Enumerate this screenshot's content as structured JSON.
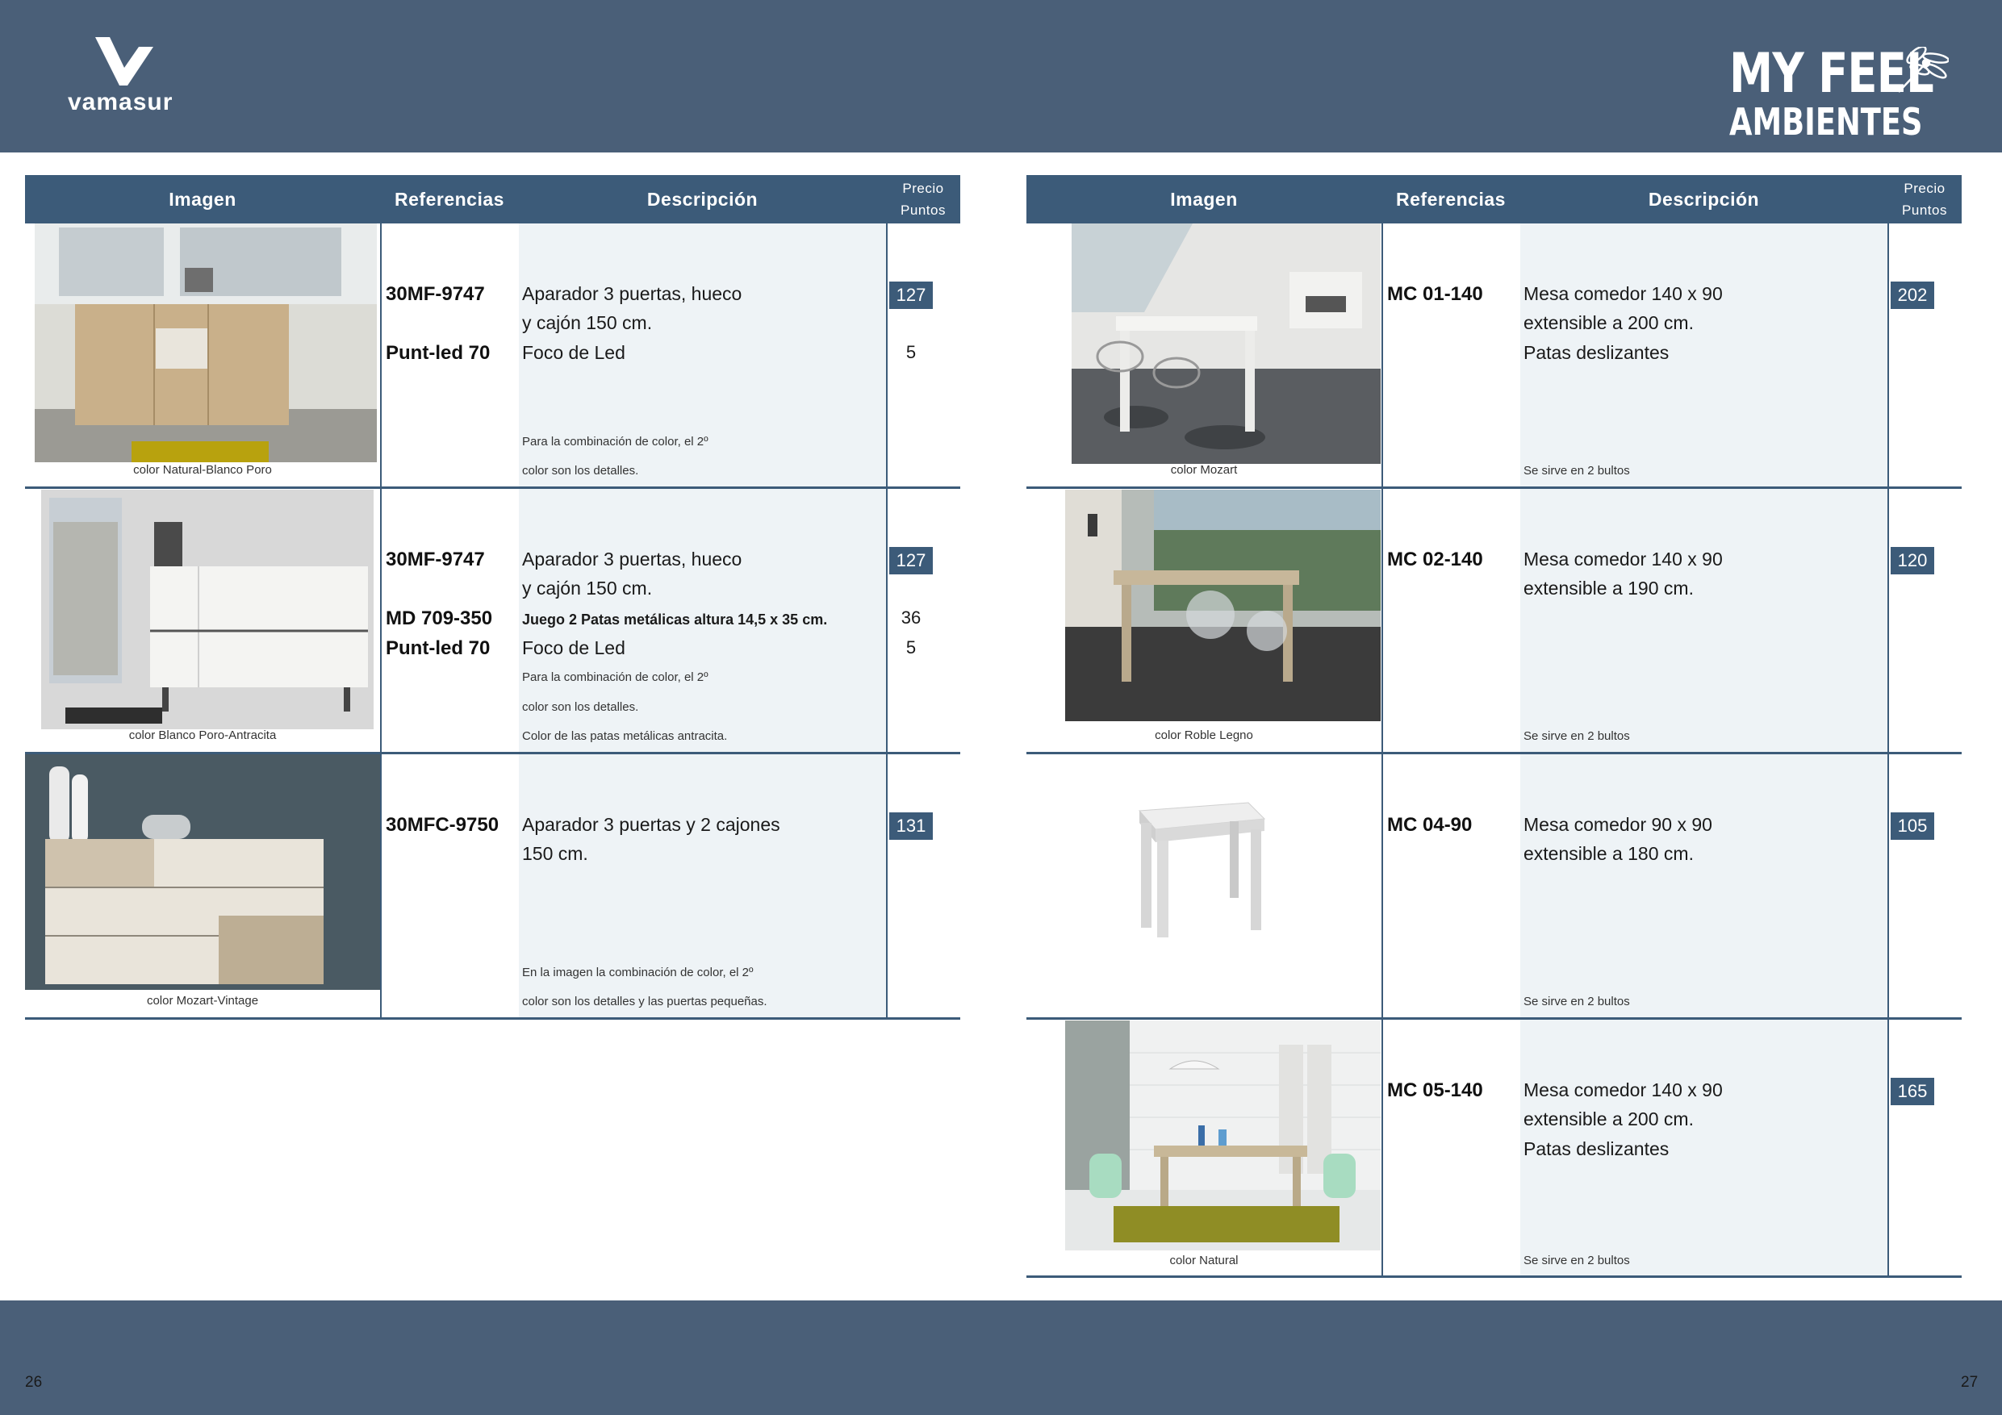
{
  "brand": {
    "left_logo": "vamasur",
    "right_line1": "MY FEEL",
    "right_line2": "AMBIENTES"
  },
  "columns": {
    "image": "Imagen",
    "refs": "Referencias",
    "desc": "Descripción",
    "price_line1": "Precio",
    "price_line2": "Puntos"
  },
  "pages": {
    "left": "26",
    "right": "27"
  },
  "left_rows": [
    {
      "caption": "color Natural-Blanco Poro",
      "refs": [
        "30MF-9747",
        "Punt-led 70"
      ],
      "desc": [
        "Aparador 3 puertas, hueco",
        "y cajón 150 cm.",
        "Foco de Led"
      ],
      "notes": [
        "Para la combinación de  color,  el  2º",
        "color son los detalles."
      ],
      "price_badge": "127",
      "price_plain": [
        "5"
      ]
    },
    {
      "caption": "color Blanco Poro-Antracita",
      "refs": [
        "30MF-9747",
        "MD 709-350",
        "Punt-led 70"
      ],
      "desc": [
        "Aparador 3 puertas, hueco",
        "y cajón 150 cm.",
        "Juego 2 Patas metálicas altura 14,5 x 35 cm.",
        "Foco de Led"
      ],
      "notes": [
        "Para la combinación de  color,  el  2º",
        "color son los detalles.",
        "Color de las patas metálicas antracita."
      ],
      "price_badge": "127",
      "price_plain": [
        "36",
        "5"
      ]
    },
    {
      "caption": "color Mozart-Vintage",
      "refs": [
        "30MFC-9750"
      ],
      "desc": [
        "Aparador 3 puertas y 2 cajones",
        "150 cm."
      ],
      "notes": [
        "En la imagen la combinación de  color,  el  2º",
        "color son los detalles y las puertas pequeñas."
      ],
      "price_badge": "131",
      "price_plain": []
    }
  ],
  "right_rows": [
    {
      "caption": "color Mozart",
      "refs": [
        "MC 01-140"
      ],
      "desc": [
        "Mesa comedor 140 x 90",
        "extensible a 200 cm.",
        "Patas deslizantes"
      ],
      "notes": [
        "Se sirve en 2 bultos"
      ],
      "price_badge": "202"
    },
    {
      "caption": "color Roble Legno",
      "refs": [
        "MC 02-140"
      ],
      "desc": [
        "Mesa comedor 140 x 90",
        "extensible a 190 cm."
      ],
      "notes": [
        "Se sirve en 2 bultos"
      ],
      "price_badge": "120"
    },
    {
      "caption": "",
      "refs": [
        "MC 04-90"
      ],
      "desc": [
        "Mesa comedor 90 x 90",
        "extensible a 180 cm."
      ],
      "notes": [
        "Se sirve en 2 bultos"
      ],
      "price_badge": "105"
    },
    {
      "caption": "color Natural",
      "refs": [
        "MC 05-140"
      ],
      "desc": [
        "Mesa comedor 140 x 90",
        "extensible a 200 cm.",
        "Patas deslizantes"
      ],
      "notes": [
        "Se sirve en 2 bultos"
      ],
      "price_badge": "165"
    }
  ]
}
